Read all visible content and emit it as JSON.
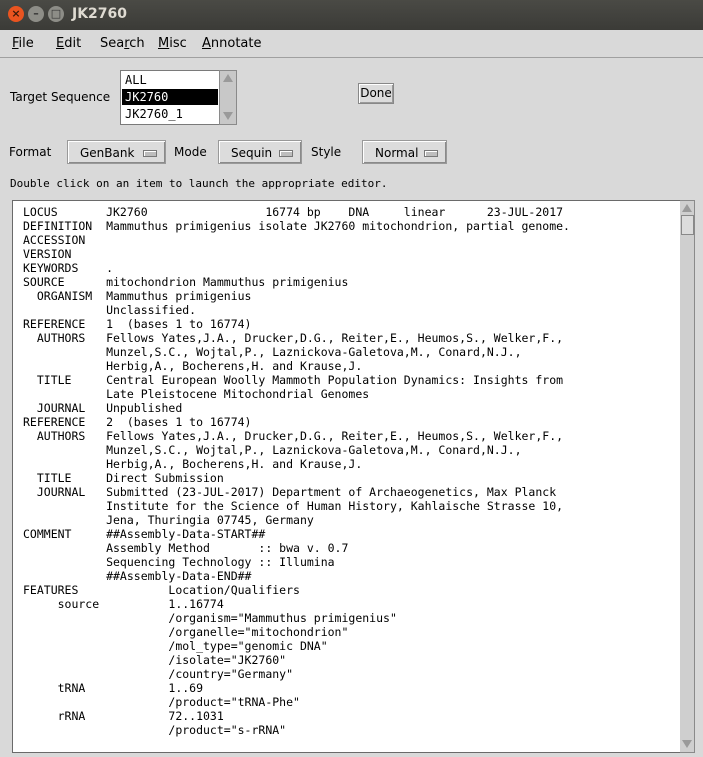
{
  "window": {
    "title": "JK2760",
    "close_glyph": "×",
    "min_glyph": "–",
    "max_glyph": "□"
  },
  "menu": [
    {
      "u": "F",
      "rest": "ile"
    },
    {
      "u": "E",
      "rest": "dit"
    },
    {
      "pre": "Sea",
      "u": "r",
      "rest": "ch"
    },
    {
      "u": "M",
      "rest": "isc"
    },
    {
      "u": "A",
      "rest": "nnotate"
    }
  ],
  "target": {
    "label": "Target Sequence",
    "items": [
      "ALL SEQUENCES",
      "JK2760",
      "JK2760_1"
    ],
    "selected_index": 1
  },
  "done_label": "Done",
  "format": {
    "label": "Format",
    "value": "GenBank"
  },
  "mode": {
    "label": "Mode",
    "value": "Sequin"
  },
  "style": {
    "label": "Style",
    "value": "Normal"
  },
  "hint": "Double click on an item to launch the appropriate editor.",
  "record_lines": [
    "LOCUS       JK2760                 16774 bp    DNA     linear      23-JUL-2017",
    "DEFINITION  Mammuthus primigenius isolate JK2760 mitochondrion, partial genome.",
    "ACCESSION",
    "VERSION",
    "KEYWORDS    .",
    "SOURCE      mitochondrion Mammuthus primigenius",
    "  ORGANISM  Mammuthus primigenius",
    "            Unclassified.",
    "REFERENCE   1  (bases 1 to 16774)",
    "  AUTHORS   Fellows Yates,J.A., Drucker,D.G., Reiter,E., Heumos,S., Welker,F.,",
    "            Munzel,S.C., Wojtal,P., Laznickova-Galetova,M., Conard,N.J.,",
    "            Herbig,A., Bocherens,H. and Krause,J.",
    "  TITLE     Central European Woolly Mammoth Population Dynamics: Insights from",
    "            Late Pleistocene Mitochondrial Genomes",
    "  JOURNAL   Unpublished",
    "REFERENCE   2  (bases 1 to 16774)",
    "  AUTHORS   Fellows Yates,J.A., Drucker,D.G., Reiter,E., Heumos,S., Welker,F.,",
    "            Munzel,S.C., Wojtal,P., Laznickova-Galetova,M., Conard,N.J.,",
    "            Herbig,A., Bocherens,H. and Krause,J.",
    "  TITLE     Direct Submission",
    "  JOURNAL   Submitted (23-JUL-2017) Department of Archaeogenetics, Max Planck",
    "            Institute for the Science of Human History, Kahlaische Strasse 10,",
    "            Jena, Thuringia 07745, Germany",
    "COMMENT     ##Assembly-Data-START##",
    "            Assembly Method       :: bwa v. 0.7",
    "            Sequencing Technology :: Illumina",
    "            ##Assembly-Data-END##",
    "FEATURES             Location/Qualifiers",
    "     source          1..16774",
    "                     /organism=\"Mammuthus primigenius\"",
    "                     /organelle=\"mitochondrion\"",
    "                     /mol_type=\"genomic DNA\"",
    "                     /isolate=\"JK2760\"",
    "                     /country=\"Germany\"",
    "     tRNA            1..69",
    "                     /product=\"tRNA-Phe\"",
    "     rRNA            72..1031",
    "                     /product=\"s-rRNA\""
  ]
}
